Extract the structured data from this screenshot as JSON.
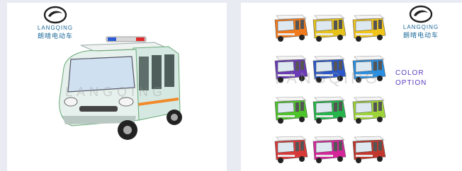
{
  "brand": {
    "name": "LANGQING",
    "chinese_name": "朗晴电动车",
    "logo_color": "#1b6a9a"
  },
  "left_panel": {
    "watermark": "LANGQING",
    "vehicle": "police-patrol-cart"
  },
  "right_panel": {
    "watermark": "LANGQING",
    "color_option_line1": "COLOR",
    "color_option_line2": "OPTION",
    "swatches": [
      {
        "color": "#f07a1c"
      },
      {
        "color": "#e6c21a"
      },
      {
        "color": "#f0c419"
      },
      {
        "color": "#6a3bb5"
      },
      {
        "color": "#2a58c8"
      },
      {
        "color": "#2a8fe0"
      },
      {
        "color": "#4cc42a"
      },
      {
        "color": "#25b54b"
      },
      {
        "color": "#9ed43a"
      },
      {
        "color": "#d83a3a"
      },
      {
        "color": "#d4279a"
      },
      {
        "color": "#c0382d"
      }
    ]
  }
}
